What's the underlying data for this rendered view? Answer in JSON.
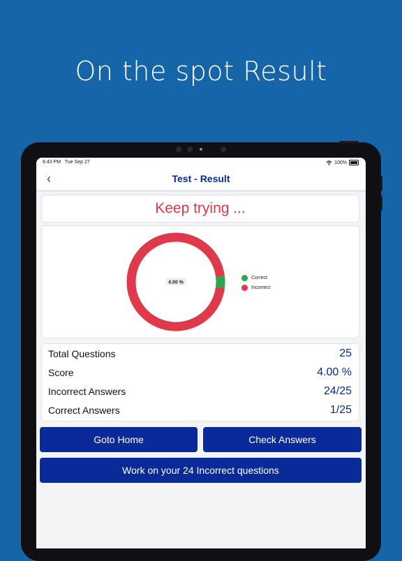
{
  "headline": "On the spot Result",
  "status_bar": {
    "time": "6:43 PM",
    "date": "Tue Sep 27",
    "battery": "100%"
  },
  "nav": {
    "back_icon": "chevron-left-icon",
    "title": "Test - Result"
  },
  "result_message": "Keep trying ...",
  "chart_data": {
    "type": "pie",
    "center_label": "4.00 %",
    "slices": [
      {
        "label": "Correct",
        "value": 4.0,
        "color": "#2aa84a"
      },
      {
        "label": "Incorrect",
        "value": 96.0,
        "color": "#de3a4c"
      }
    ],
    "legend_position": "right"
  },
  "stats": [
    {
      "label": "Total Questions",
      "value": "25"
    },
    {
      "label": "Score",
      "value": "4.00 %"
    },
    {
      "label": "Incorrect Answers",
      "value": "24/25"
    },
    {
      "label": "Correct Answers",
      "value": "1/25"
    }
  ],
  "buttons": {
    "home": "Goto Home",
    "check": "Check Answers",
    "work": "Work on your 24 Incorrect questions"
  },
  "colors": {
    "background": "#1565a8",
    "primary": "#0b2a9a",
    "title": "#0b2a8c",
    "danger": "#d9394b",
    "success": "#2aa84a"
  }
}
